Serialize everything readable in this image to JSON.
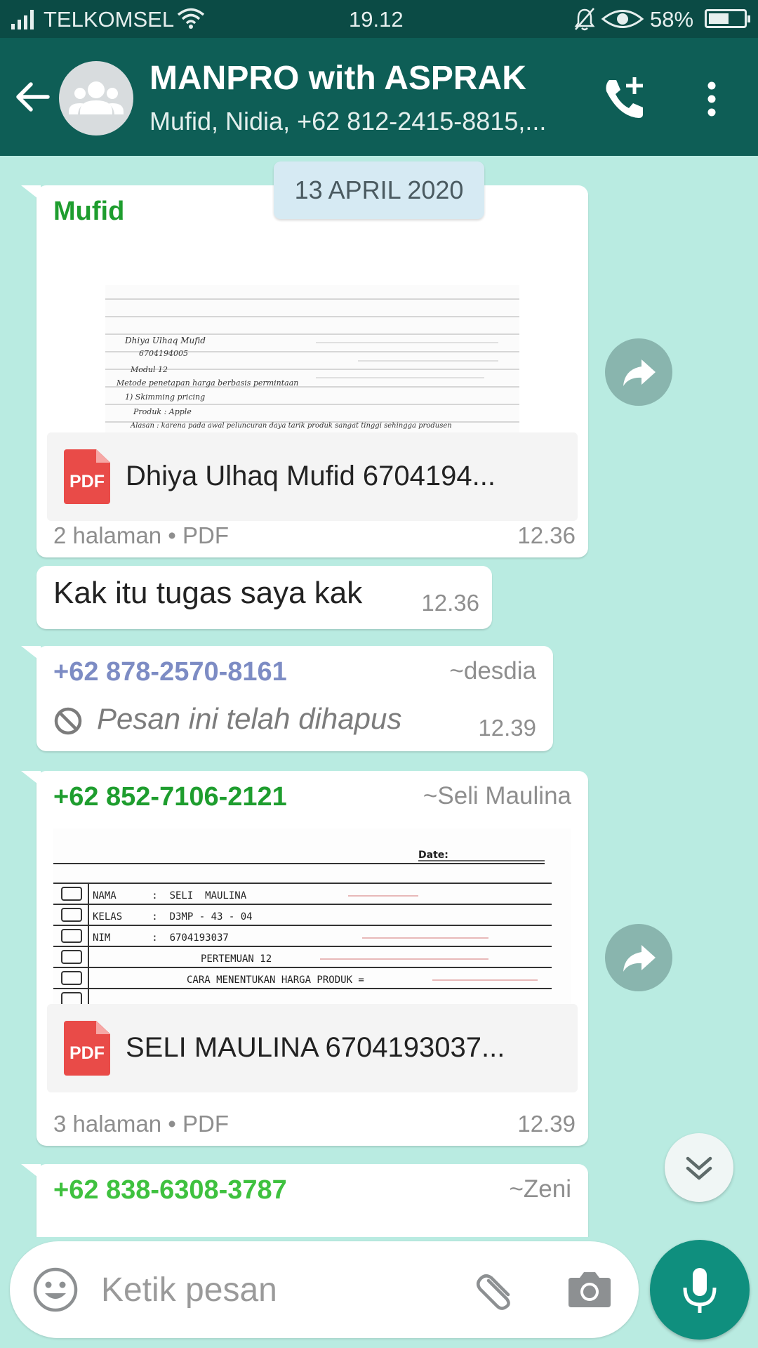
{
  "status_bar": {
    "carrier": "TELKOMSEL",
    "time": "19.12",
    "battery_percent": "58%",
    "battery_level": 0.58
  },
  "header": {
    "title": "MANPRO with ASPRAK",
    "members": "Mufid, Nidia, +62 812-2415-8815,..."
  },
  "chat": {
    "date_chip": "13 APRIL 2020",
    "messages": [
      {
        "sender": "Mufid",
        "sender_color": "#1e9d2e",
        "preview_lines": [
          "Dhiya Ulhaq Mufid",
          "6704194005",
          "Modul 12",
          "Metode penetapan harga berbasis permintaan",
          "1) Skimming pricing",
          "Produk : Apple",
          "Alasan : karena pada awal peluncuran daya tarik produk sangat tinggi sehingga produsen"
        ],
        "document_name": "Dhiya Ulhaq Mufid 6704194...",
        "document_meta": "2 halaman • PDF",
        "time": "12.36",
        "pdf_label": "PDF"
      },
      {
        "text": "Kak itu tugas saya kak",
        "time": "12.36"
      },
      {
        "sender": "+62 878-2570-8161",
        "sender_color": "#7d8cc4",
        "alias": "~desdia",
        "deleted_text": "Pesan ini telah dihapus",
        "time": "12.39"
      },
      {
        "sender": "+62 852-7106-2121",
        "sender_color": "#1e9d2e",
        "alias": "~Seli Maulina",
        "preview_date_label": "Date:",
        "preview_rows": [
          "NAMA      :  SELI  MAULINA",
          "KELAS     :  D3MP - 43 - 04",
          "NIM       :  6704193037",
          "PERTEMUAN 12",
          "CARA MENENTUKAN HARGA PRODUK ="
        ],
        "document_name": "SELI MAULINA 6704193037...",
        "document_meta": "3 halaman • PDF",
        "time": "12.39",
        "pdf_label": "PDF"
      },
      {
        "sender": "+62 838-6308-3787",
        "sender_color": "#3fc13f",
        "alias": "~Zeni"
      }
    ]
  },
  "input": {
    "placeholder": "Ketik pesan"
  },
  "colors": {
    "header": "#0e5e56",
    "status_bar": "#0b4b45",
    "chat_background": "#b9ebe1",
    "mic_button": "#0f8f7e"
  },
  "icons": [
    "back-arrow-icon",
    "group-avatar-icon",
    "add-call-icon",
    "more-vert-icon",
    "share-icon",
    "block-icon",
    "chevron-double-down-icon",
    "emoji-icon",
    "paperclip-icon",
    "camera-icon",
    "mic-icon"
  ]
}
